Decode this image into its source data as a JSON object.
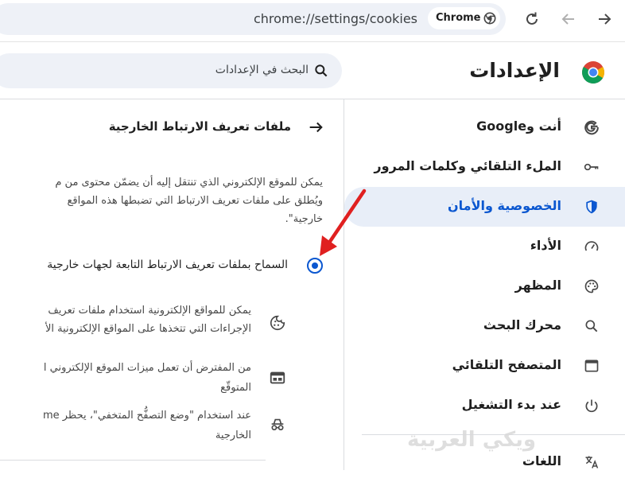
{
  "browser": {
    "url": "chrome://settings/cookies",
    "chip_label": "Chrome"
  },
  "header": {
    "title": "الإعدادات",
    "search_placeholder": "البحث في الإعدادات"
  },
  "sidebar": {
    "items": [
      {
        "label": "أنت وGoogle",
        "icon": "google-icon"
      },
      {
        "label": "الملء التلقائي وكلمات المرور",
        "icon": "key-icon"
      },
      {
        "label": "الخصوصية والأمان",
        "icon": "shield-icon",
        "active": true
      },
      {
        "label": "الأداء",
        "icon": "speedometer-icon"
      },
      {
        "label": "المظهر",
        "icon": "palette-icon"
      },
      {
        "label": "محرك البحث",
        "icon": "search-icon"
      },
      {
        "label": "المتصفح التلقائي",
        "icon": "browser-window-icon"
      },
      {
        "label": "عند بدء التشغيل",
        "icon": "power-icon"
      },
      {
        "label": "اللغات",
        "icon": "translate-icon"
      }
    ]
  },
  "main": {
    "title": "ملفات تعريف الارتباط الخارجية",
    "description_lines": [
      "يمكن للموقع الإلكتروني الذي تنتقل إليه أن يضمّن محتوى من م",
      "ويُطلق على ملفات تعريف الارتباط التي تضبطها هذه المواقع",
      "خارجية\"."
    ],
    "radio_option": "السماح بملفات تعريف الارتباط التابعة لجهات خارجية",
    "options": [
      {
        "icon": "cookie-icon",
        "lines": [
          "يمكن للمواقع الإلكترونية استخدام ملفات تعريف",
          "الإجراءات التي تتخذها على المواقع الإلكترونية الأ"
        ]
      },
      {
        "icon": "web-window-icon",
        "lines": [
          "من المفترض أن تعمل ميزات الموقع الإلكتروني ا",
          "المتوقّع"
        ]
      },
      {
        "icon": "incognito-icon",
        "lines": [
          "عند استخدام \"وضع التصفُّح المتخفي\"، يحظر me",
          "الخارجية"
        ]
      }
    ]
  },
  "watermark": "ويكي العربية",
  "colors": {
    "accent": "#0b57d0",
    "active_bg": "#e8eef8",
    "arrow": "#e02020"
  }
}
